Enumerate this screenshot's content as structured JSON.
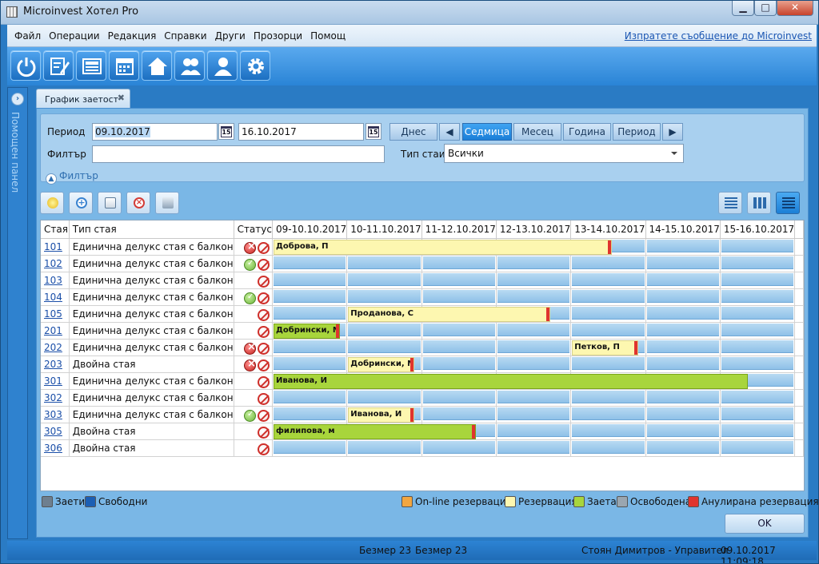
{
  "window": {
    "title": "Microinvest Хотел Pro",
    "min": "▁",
    "max": "□",
    "close": "✕"
  },
  "menu": {
    "items": [
      "Файл",
      "Операции",
      "Редакция",
      "Справки",
      "Други",
      "Прозорци",
      "Помощ"
    ],
    "message_link": "Изпратете съобщение до Microinvest"
  },
  "toolbar": {
    "buttons": [
      "power-icon",
      "edit-document-icon",
      "newspaper-icon",
      "calendar-icon",
      "home-icon",
      "users-icon",
      "user-icon",
      "gear-icon"
    ]
  },
  "side_panel": {
    "label": "Помощен панел"
  },
  "tab": {
    "label": "График заетост",
    "close": "✖"
  },
  "filter": {
    "period_label": "Период",
    "date_from": "09.10.2017",
    "date_to": "16.10.2017",
    "today_btn": "Днес",
    "period_buttons": [
      "Седмица",
      "Месец",
      "Година",
      "Период"
    ],
    "selected_period": "Седмица",
    "filter_label": "Филтър",
    "filter_value": "",
    "room_type_label": "Тип стаи",
    "room_type_value": "Всички",
    "toggle_label": "Филтър"
  },
  "grid": {
    "headers": {
      "room": "Стая",
      "type": "Тип стая",
      "status": "Статус"
    },
    "days": [
      "09-10.10.2017",
      "10-11.10.2017",
      "11-12.10.2017",
      "12-13.10.2017",
      "13-14.10.2017",
      "14-15.10.2017",
      "15-16.10.2017"
    ],
    "rows": [
      {
        "room": "101",
        "type": "Единична делукс стая с балкон",
        "status": [
          "x",
          "no"
        ]
      },
      {
        "room": "102",
        "type": "Единична делукс стая с балкон",
        "status": [
          "ok",
          "no"
        ]
      },
      {
        "room": "103",
        "type": "Единична делукс стая с балкон",
        "status": [
          "no"
        ]
      },
      {
        "room": "104",
        "type": "Единична делукс стая с балкон",
        "status": [
          "ok",
          "no"
        ]
      },
      {
        "room": "105",
        "type": "Единична делукс стая с балкон",
        "status": [
          "no"
        ]
      },
      {
        "room": "201",
        "type": "Единична делукс стая с балкон",
        "status": [
          "no"
        ]
      },
      {
        "room": "202",
        "type": "Единична делукс стая с балкон",
        "status": [
          "x",
          "no"
        ]
      },
      {
        "room": "203",
        "type": "Двойна стая",
        "status": [
          "x",
          "no"
        ]
      },
      {
        "room": "301",
        "type": "Единична делукс стая с балкон",
        "status": [
          "no"
        ]
      },
      {
        "room": "302",
        "type": "Единична делукс стая с балкон",
        "status": [
          "no"
        ]
      },
      {
        "room": "303",
        "type": "Единична делукс стая с балкон",
        "status": [
          "ok",
          "no"
        ]
      },
      {
        "room": "305",
        "type": "Двойна стая",
        "status": [
          "no"
        ]
      },
      {
        "room": "306",
        "type": "Двойна стая",
        "status": [
          "no"
        ]
      }
    ],
    "bookings": [
      {
        "row": 0,
        "start": 0,
        "len": 5,
        "kind": "res",
        "name": "Доброва, П",
        "cancel": true
      },
      {
        "row": 4,
        "start": 1,
        "len": 3,
        "kind": "res",
        "name": "Проданова, С",
        "cancel": true
      },
      {
        "row": 5,
        "start": 0,
        "len": 1,
        "kind": "occ",
        "name": "Добрински, М",
        "cancel": true
      },
      {
        "row": 6,
        "start": 4,
        "len": 1,
        "kind": "res",
        "name": "Петков, П",
        "cancel": true
      },
      {
        "row": 7,
        "start": 1,
        "len": 1,
        "kind": "res",
        "name": "Добрински, М",
        "cancel": true
      },
      {
        "row": 8,
        "start": 0,
        "len": 7,
        "kind": "occ",
        "name": "Иванова, И",
        "cancel": false
      },
      {
        "row": 10,
        "start": 1,
        "len": 1,
        "kind": "res",
        "name": "Иванова, И",
        "cancel": true
      },
      {
        "row": 11,
        "start": 0,
        "len": 3,
        "kind": "occ",
        "name": "филипова, м",
        "cancel": true
      }
    ]
  },
  "legend": {
    "left": [
      {
        "label": "Заети",
        "color": "#6e7f8f"
      },
      {
        "label": "Свободни",
        "color": "#1c5fb4"
      }
    ],
    "right": [
      {
        "label": "On-line резервация",
        "color": "#f2a640"
      },
      {
        "label": "Резервация",
        "color": "#fdf7b0"
      },
      {
        "label": "Заета",
        "color": "#a8d53c"
      },
      {
        "label": "Освободена",
        "color": "#9aa6b0"
      },
      {
        "label": "Анулирана резервация",
        "color": "#e0342e"
      }
    ]
  },
  "ok_button": "OK",
  "statusbar": {
    "left1": "Безмер 23",
    "left2": "Безмер 23",
    "user": "Стоян Димитров - Управител",
    "datetime": "09.10.2017 11:09:18"
  }
}
